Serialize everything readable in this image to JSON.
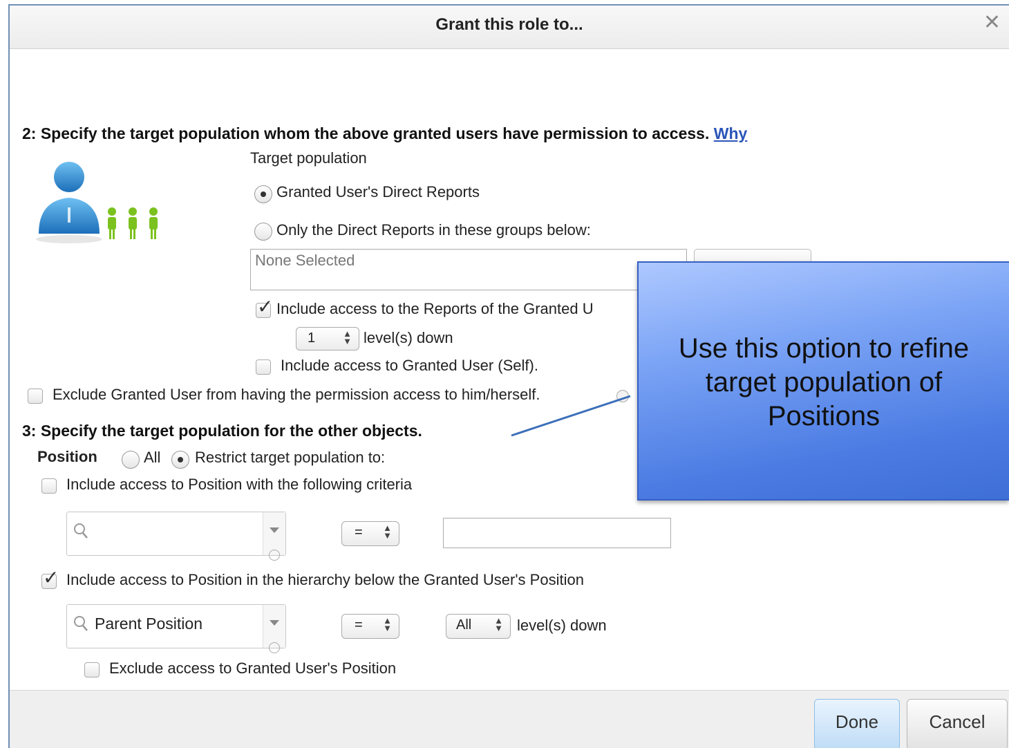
{
  "dialog": {
    "title": "Grant this role to..."
  },
  "section2": {
    "heading": "2: Specify the target population whom the above granted users have permission to access.",
    "why_link": "Why",
    "target_population_label": "Target population",
    "options": [
      {
        "label": "Granted User's Direct Reports",
        "selected": true
      },
      {
        "label": "Only the Direct Reports in these groups below:",
        "selected": false
      }
    ],
    "groups_box_value": "None Selected",
    "include_reports": {
      "label": "Include access to the Reports of the Granted U",
      "checked": true
    },
    "levels": {
      "value": "1",
      "suffix": "level(s) down"
    },
    "include_self": {
      "label": "Include access to Granted User (Self).",
      "checked": false
    },
    "exclude_self": {
      "label": "Exclude Granted User from having the permission access to him/herself.",
      "checked": false
    }
  },
  "section3": {
    "heading": "3: Specify the target population for the other objects.",
    "object_label": "Position",
    "scope_options": [
      {
        "label": "All",
        "selected": false
      },
      {
        "label": "Restrict target population to:",
        "selected": true
      }
    ],
    "criteria": {
      "label": "Include access to Position with the following criteria",
      "checked": false,
      "field_value": "",
      "operator": "=",
      "value": ""
    },
    "hierarchy": {
      "label": "Include access to Position in the hierarchy below the Granted User's Position",
      "checked": true,
      "field_value": "Parent Position",
      "operator": "=",
      "levels_value": "All",
      "levels_suffix": "level(s) down"
    },
    "exclude_position": {
      "label": "Exclude access to Granted User's Position",
      "checked": false
    }
  },
  "footer": {
    "done_label": "Done",
    "cancel_label": "Cancel"
  },
  "callout": {
    "lines": [
      "Use this option to refine",
      "target population of",
      "Positions"
    ]
  },
  "colors": {
    "dialog_border": "#6f8fb5",
    "link": "#2a55b8",
    "callout_fill": "#4c7ce3",
    "done_button": "#bfdcf6"
  },
  "icons": {
    "illustration": "manager-with-direct-reports-icon",
    "search": "magnifier-icon",
    "close": "close-icon"
  }
}
